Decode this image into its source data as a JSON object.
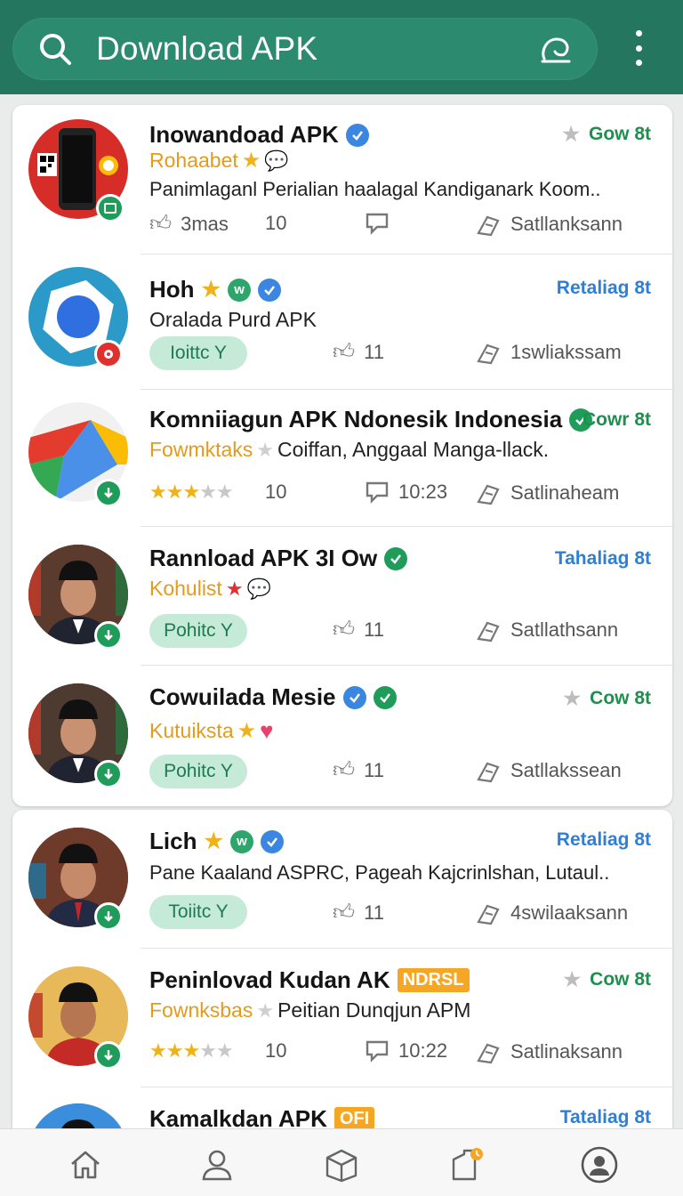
{
  "header": {
    "search_title": "Download APK",
    "icons": [
      "search-icon",
      "mic-icon",
      "more-icon"
    ]
  },
  "items": [
    {
      "title": "Inowandoad APK",
      "right": "Gow 8t",
      "sub": "Rohaabet",
      "desc": "Panimlaganl Perialian haalagal Kandiganark Koom..",
      "meta_left": "3mas",
      "meta_count": "10",
      "meta_action": "Satllanksann"
    },
    {
      "title": "Hoh",
      "right": "Retaliag 8t",
      "sub": "Oralada Purd APK",
      "pill": "Ioittc Y",
      "meta_count": "11",
      "meta_action": "1swliakssam"
    },
    {
      "title": "Komniiagun APK Ndonesik Indonesia",
      "right": "Cowr 8t",
      "sub_orange": "Fowmktaks",
      "sub_rest": "Coiffan, Anggaal Manga-llack.",
      "meta_count": "10",
      "meta_time": "10:23",
      "meta_action": "Satlinaheam"
    },
    {
      "title": "Rannload APK 3I Ow",
      "right": "Tahaliag 8t",
      "sub": "Kohulist",
      "pill": "Pohitc Y",
      "meta_count": "11",
      "meta_action": "Satllathsann"
    },
    {
      "title": "Cowuilada Mesie",
      "right": "Cow 8t",
      "sub": "Kutuiksta",
      "pill": "Pohitc Y",
      "meta_count": "11",
      "meta_action": "Satllakssean"
    },
    {
      "title": "Lich",
      "right": "Retaliag 8t",
      "sub": "Pane Kaaland ASPRC, Pageah Kajcrinlshan, Lutaul..",
      "pill": "Toiitc Y",
      "meta_count": "11",
      "meta_action": "4swilaaksann"
    },
    {
      "title": "Peninlovad Kudan AK",
      "tag": "NDRSL",
      "right": "Cow 8t",
      "sub_orange": "Fownksbas",
      "sub_rest": "Peitian Dunqjun APM",
      "meta_count": "10",
      "meta_time": "10:22",
      "meta_action": "Satlinaksann"
    },
    {
      "title": "Kamalkdan APK",
      "tag": "OFI",
      "right": "Tataliag 8t"
    }
  ],
  "nav": [
    "home-icon",
    "profile-icon",
    "inbox-icon",
    "updates-icon",
    "account-icon"
  ],
  "colors": {
    "header": "#25765f",
    "search": "#2c8a6f",
    "accent_green": "#1e8f4e",
    "accent_blue": "#2f7fd6",
    "orange": "#e49a1c"
  }
}
